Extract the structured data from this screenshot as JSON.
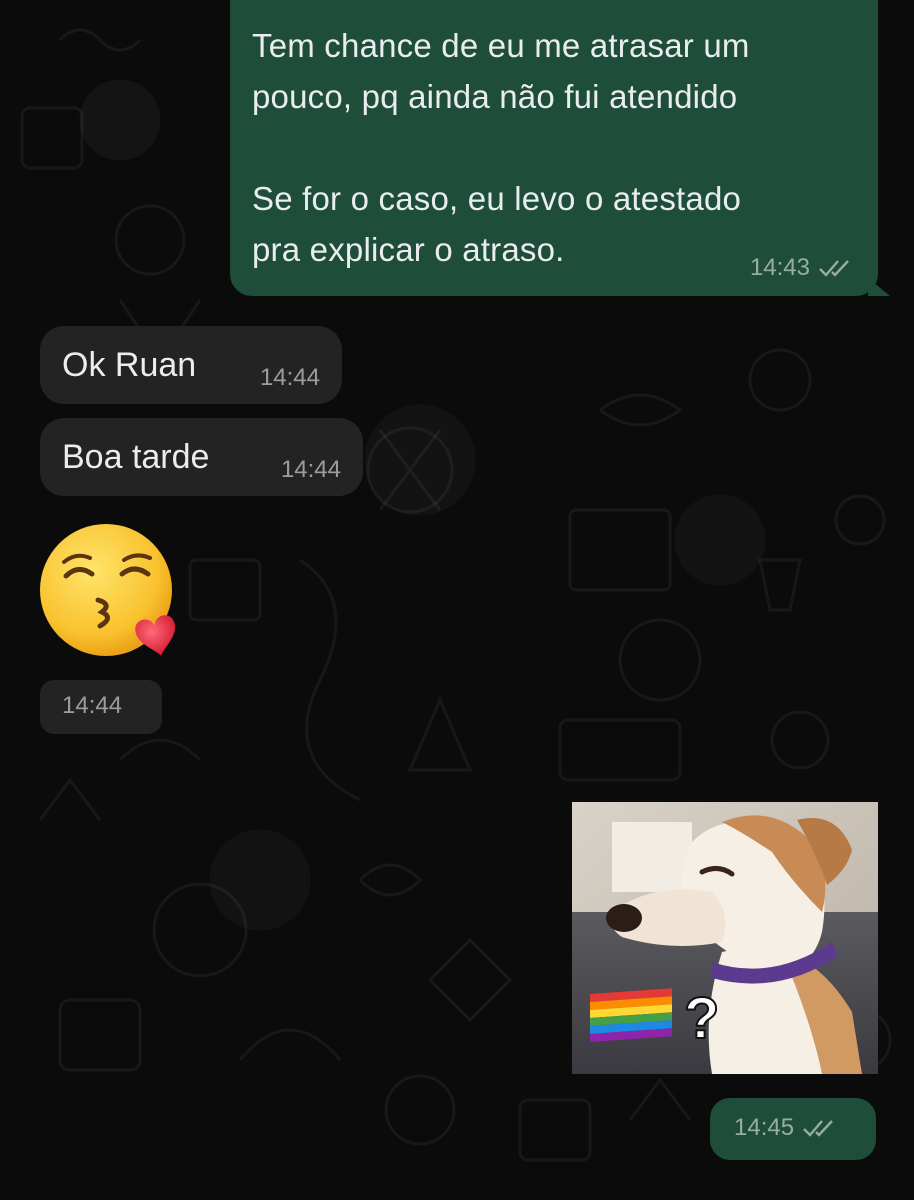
{
  "messages": [
    {
      "direction": "outgoing",
      "text": "Tem chance de eu me atrasar um\npouco, pq ainda não fui atendido\n\nSe for o caso, eu levo o atestado\npra explicar o atraso.",
      "time": "14:43",
      "status": "read"
    },
    {
      "direction": "incoming",
      "text": "Ok Ruan",
      "time": "14:44"
    },
    {
      "direction": "incoming",
      "text": "Boa tarde",
      "time": "14:44"
    },
    {
      "direction": "incoming",
      "type": "emoji",
      "emoji": "kissing-heart-emoji",
      "time": "14:44"
    },
    {
      "direction": "outgoing",
      "type": "sticker",
      "sticker": "dog-meme-sticker",
      "sticker_text": "?",
      "time": "14:45",
      "status": "read"
    }
  ],
  "colors": {
    "background": "#0b0b0b",
    "outgoing_bubble": "#1e4d3a",
    "incoming_bubble": "#232323",
    "text": "#e9edef",
    "meta_text": "#9aa3a6"
  }
}
